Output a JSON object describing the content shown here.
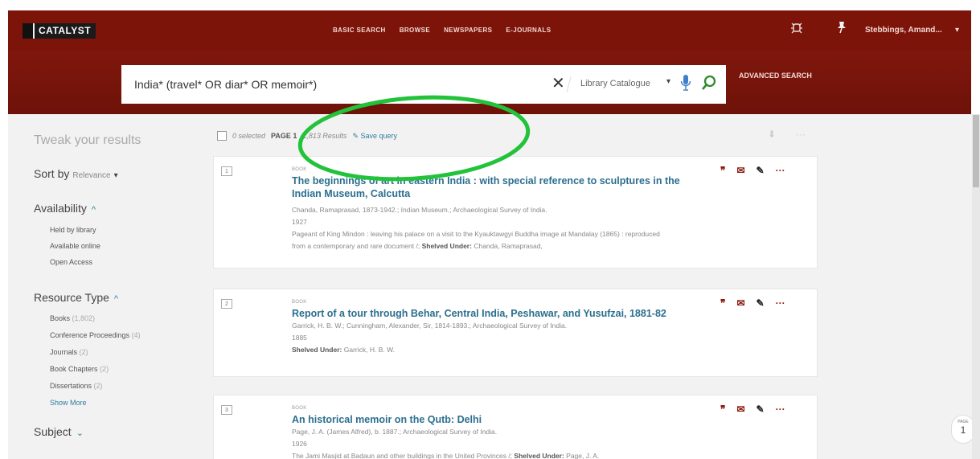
{
  "app": {
    "logo_text": "CATALYST"
  },
  "nav": [
    "BASIC SEARCH",
    "BROWSE",
    "NEWSPAPERS",
    "E-JOURNALS"
  ],
  "user": {
    "name": "Stebbings, Amand...",
    "caret": "▾"
  },
  "search": {
    "query": "India* (travel* OR diar* OR memoir*)",
    "scope": "Library Catalogue",
    "scope_caret": "▾",
    "clear_glyph": "✕",
    "advanced_label": "ADVANCED SEARCH"
  },
  "sidebar": {
    "title": "Tweak your results",
    "sort_label": "Sort by",
    "sort_value": "Relevance",
    "sort_caret": "▾",
    "availability_label": "Availability",
    "availability_items": [
      "Held by library",
      "Available online",
      "Open Access"
    ],
    "resource_type_label": "Resource Type",
    "resource_items": [
      {
        "label": "Books",
        "count": "(1,802)"
      },
      {
        "label": "Conference Proceedings",
        "count": "(4)"
      },
      {
        "label": "Journals",
        "count": "(2)"
      },
      {
        "label": "Book Chapters",
        "count": "(2)"
      },
      {
        "label": "Dissertations",
        "count": "(2)"
      }
    ],
    "show_more": "Show More",
    "subject_label": "Subject",
    "chev_up": "^",
    "chev_down": "⌄"
  },
  "results_bar": {
    "selected": "0 selected",
    "page": "PAGE 1",
    "count": "1,813 Results",
    "save_query": "Save query"
  },
  "results": [
    {
      "num": "1",
      "type": "BOOK",
      "title": "The beginnings of art in eastern India : with special reference to sculptures in the Indian Museum, Calcutta",
      "authors": "Chanda, Ramaprasad, 1873-1942.; Indian Museum.; Archaeological Survey of India.",
      "year": "1927",
      "extra": "Pageant of King Mindon : leaving his palace on a visit to the Kyauktawgyi Buddha image at Mandalay (1865) : reproduced",
      "extra2_pre": "from a contemporary and rare document /;",
      "shelved_label": "Shelved Under:",
      "shelved_value": "Chanda, Ramaprasad,"
    },
    {
      "num": "2",
      "type": "BOOK",
      "title": "Report of a tour through Behar, Central India, Peshawar, and Yusufzai, 1881-82",
      "authors": "Garrick, H. B. W.; Cunningham, Alexander, Sir, 1814-1893.; Archaeological Survey of India.",
      "year": "1885",
      "shelved_label": "Shelved Under:",
      "shelved_value": "Garrick, H. B. W."
    },
    {
      "num": "3",
      "type": "BOOK",
      "title": "An historical memoir on the Qutb: Delhi",
      "authors": "Page, J. A. (James Alfred), b. 1887.; Archaeological Survey of India.",
      "year": "1926",
      "extra": "The Jami Masjid at Badaun and other buildings in the United Provinces /;",
      "shelved_label": "Shelved Under:",
      "shelved_value": "Page, J. A."
    }
  ],
  "page_indicator": {
    "label": "PAGE",
    "number": "1"
  },
  "colors": {
    "brand": "#7c1409",
    "link": "#2b6f8f",
    "annotation": "#22c33a"
  }
}
